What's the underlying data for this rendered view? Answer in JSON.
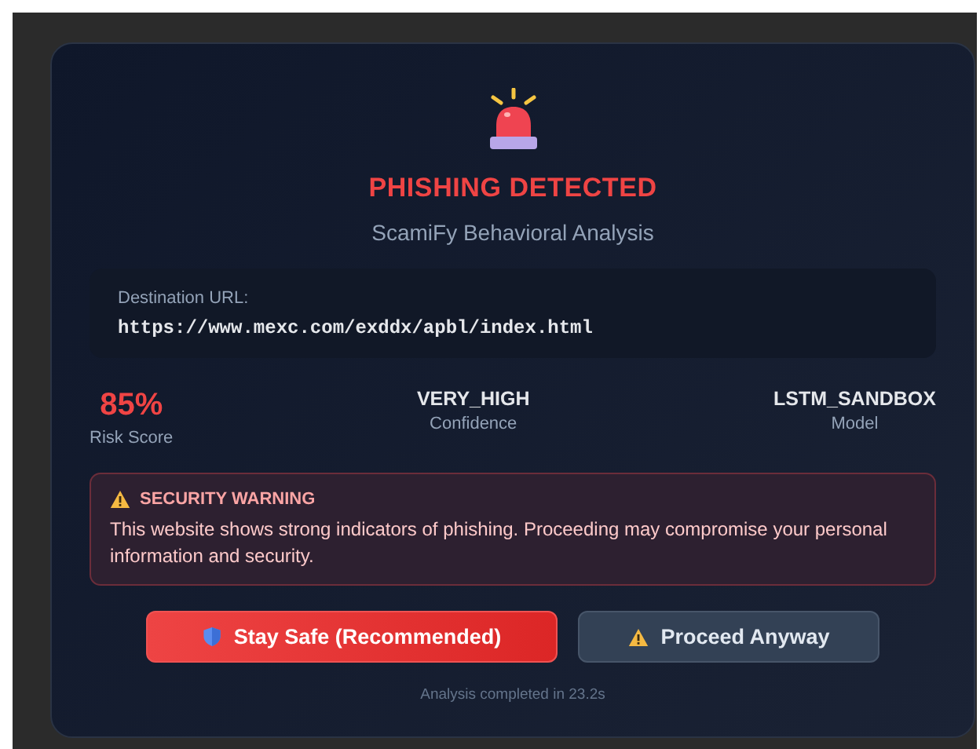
{
  "alert": {
    "title": "PHISHING DETECTED",
    "subtitle": "ScamiFy Behavioral Analysis"
  },
  "destination": {
    "label": "Destination URL:",
    "url": "https://www.mexc.com/exddx/apbl/index.html"
  },
  "stats": [
    {
      "value": "85%",
      "label": "Risk Score",
      "kind": "risk"
    },
    {
      "value": "VERY_HIGH",
      "label": "Confidence",
      "kind": "plain"
    },
    {
      "value": "LSTM_SANDBOX",
      "label": "Model",
      "kind": "plain"
    }
  ],
  "warning": {
    "title": "SECURITY WARNING",
    "message": "This website shows strong indicators of phishing. Proceeding may compromise your personal information and security."
  },
  "buttons": [
    {
      "label": "Stay Safe (Recommended)",
      "kind": "primary"
    },
    {
      "label": "Proceed Anyway",
      "kind": "secondary"
    }
  ],
  "footer": "Analysis completed in 23.2s"
}
